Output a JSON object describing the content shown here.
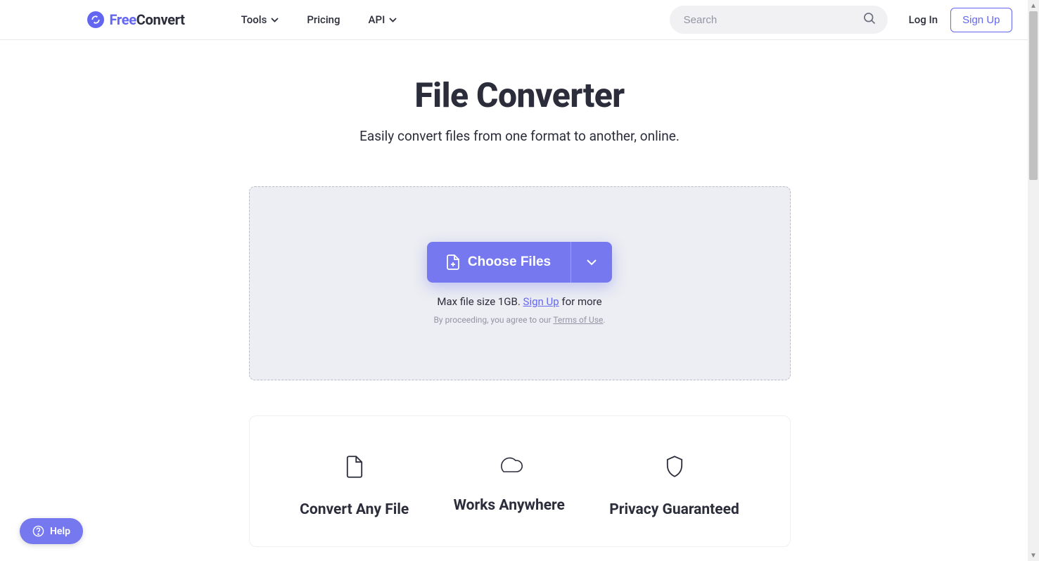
{
  "header": {
    "logo_free": "Free",
    "logo_convert": "Convert",
    "nav": {
      "tools": "Tools",
      "pricing": "Pricing",
      "api": "API"
    },
    "search_placeholder": "Search",
    "login": "Log In",
    "signup": "Sign Up"
  },
  "main": {
    "title": "File Converter",
    "subtitle": "Easily convert files from one format to another, online.",
    "choose_files": "Choose Files",
    "max_prefix": "Max file size 1GB. ",
    "max_signup": "Sign Up",
    "max_suffix": " for more",
    "terms_prefix": "By proceeding, you agree to our ",
    "terms_link": "Terms of Use",
    "terms_suffix": "."
  },
  "features": {
    "f1": "Convert Any File",
    "f2": "Works Anywhere",
    "f3": "Privacy Guaranteed"
  },
  "help": {
    "label": "Help"
  }
}
